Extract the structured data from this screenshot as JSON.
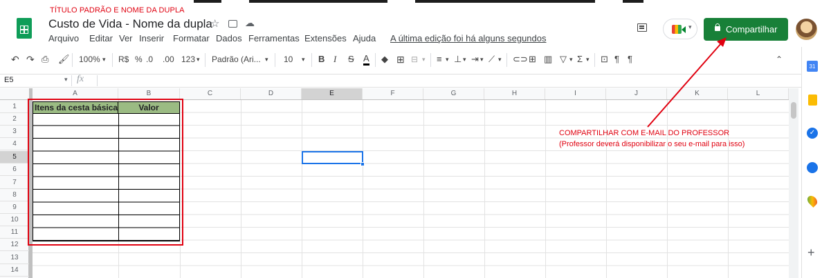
{
  "annotation_title": "TÍTULO PADRÃO E NOME DA DUPLA",
  "doc_title": "Custo de Vida - Nome da dupla",
  "menu": [
    "Arquivo",
    "Editar",
    "Ver",
    "Inserir",
    "Formatar",
    "Dados",
    "Ferramentas",
    "Extensões",
    "Ajuda"
  ],
  "last_edit": "A última edição foi há alguns segundos",
  "share_label": "Compartilhar",
  "toolbar": {
    "zoom": "100%",
    "currency": "R$",
    "percent": "%",
    "dec_less": ".0",
    "dec_more": ".00",
    "format": "123",
    "font": "Padrão (Ari...",
    "font_size": "10",
    "bold": "B",
    "italic": "I",
    "strike": "S",
    "text_color": "A"
  },
  "formula_bar": {
    "cell_ref": "E5",
    "fx": "fx"
  },
  "columns": [
    "A",
    "B",
    "C",
    "D",
    "E",
    "F",
    "G",
    "H",
    "I",
    "J",
    "K",
    "L"
  ],
  "rows": [
    "1",
    "2",
    "3",
    "4",
    "5",
    "6",
    "7",
    "8",
    "9",
    "10",
    "11",
    "12",
    "13",
    "14"
  ],
  "table": {
    "header_a": "Itens da cesta básica",
    "header_b": "Valor"
  },
  "annotation_share": {
    "line1": "COMPARTILHAR COM E-MAIL DO PROFESSOR",
    "line2": "(Professor deverá disponibilizar o seu e-mail para isso)"
  },
  "colors": {
    "accent_green": "#188038",
    "annotation_red": "#e0000f",
    "header_fill": "#9bbb83",
    "selection_blue": "#1a73e8"
  }
}
